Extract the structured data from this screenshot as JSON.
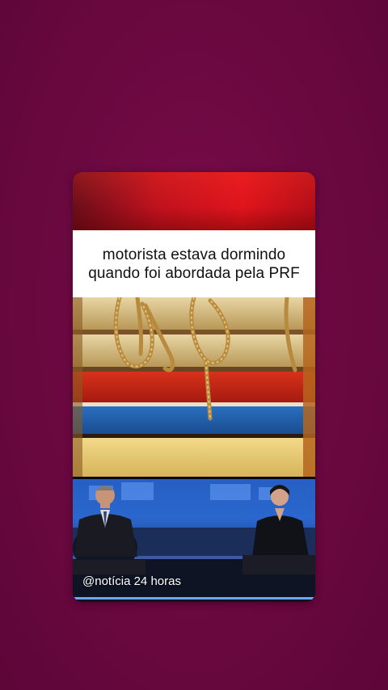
{
  "caption": {
    "text": "motorista estava dormindo quando foi abordada pela PRF"
  },
  "watermark": {
    "text": "@notícia 24 horas"
  },
  "colors": {
    "background": "#6d0a40",
    "caption_bg": "#ffffff",
    "top_strip": "#d0141c"
  }
}
